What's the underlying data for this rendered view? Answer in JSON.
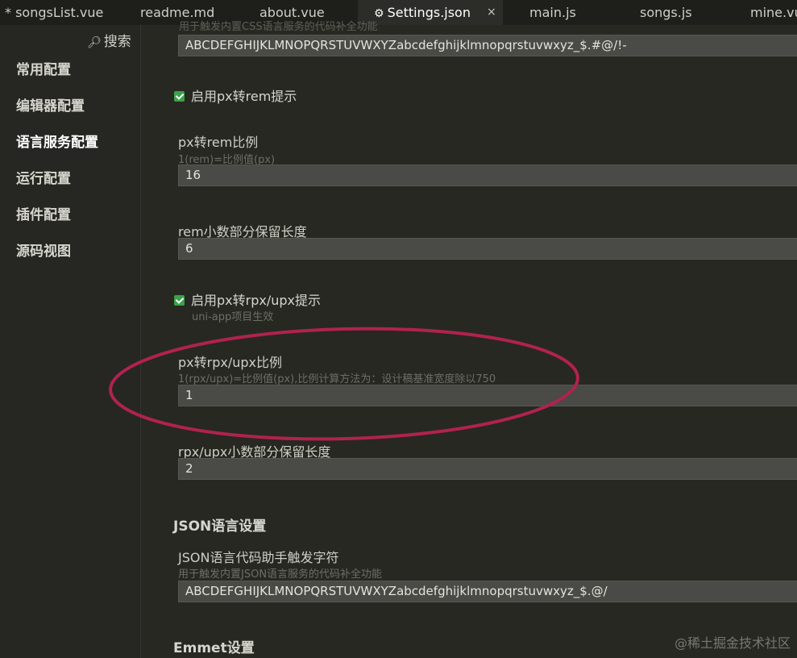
{
  "tabs": [
    {
      "label": "* songsList.vue"
    },
    {
      "label": "readme.md"
    },
    {
      "label": "about.vue"
    },
    {
      "label": "Settings.json",
      "close": "×"
    },
    {
      "label": "main.js"
    },
    {
      "label": "songs.js"
    },
    {
      "label": "mine.vu"
    }
  ],
  "sidebar": {
    "search_label": "搜索",
    "items": [
      {
        "label": "常用配置"
      },
      {
        "label": "编辑器配置"
      },
      {
        "label": "语言服务配置"
      },
      {
        "label": "运行配置"
      },
      {
        "label": "插件配置"
      },
      {
        "label": "源码视图"
      }
    ]
  },
  "settings": {
    "top_hint": "用于触发内置CSS语言服务的代码补全功能",
    "top_value": "ABCDEFGHIJKLMNOPQRSTUVWXYZabcdefghijklmnopqrstuvwxyz_$.#@/!-",
    "px_rem_toggle": "启用px转rem提示",
    "px_rem_ratio_label": "px转rem比例",
    "px_rem_ratio_hint": "1(rem)=比例值(px)",
    "px_rem_ratio_value": "16",
    "rem_decimal_label": "rem小数部分保留长度",
    "rem_decimal_value": "6",
    "px_rpx_toggle": "启用px转rpx/upx提示",
    "px_rpx_toggle_hint": "uni-app项目生效",
    "px_rpx_ratio_label": "px转rpx/upx比例",
    "px_rpx_ratio_hint": "1(rpx/upx)=比例值(px),比例计算方法为：设计稿基准宽度除以750",
    "px_rpx_ratio_value": "1",
    "rpx_decimal_label": "rpx/upx小数部分保留长度",
    "rpx_decimal_value": "2",
    "json_section_title": "JSON语言设置",
    "json_trigger_label": "JSON语言代码助手触发字符",
    "json_trigger_hint": "用于触发内置JSON语言服务的代码补全功能",
    "json_trigger_value": "ABCDEFGHIJKLMNOPQRSTUVWXYZabcdefghijklmnopqrstuvwxyz_$.@/",
    "emmet_section_title": "Emmet设置"
  },
  "watermark": "@稀土掘金技术社区",
  "colors": {
    "highlight": "#b0224f",
    "checkbox": "#3aa24a"
  }
}
